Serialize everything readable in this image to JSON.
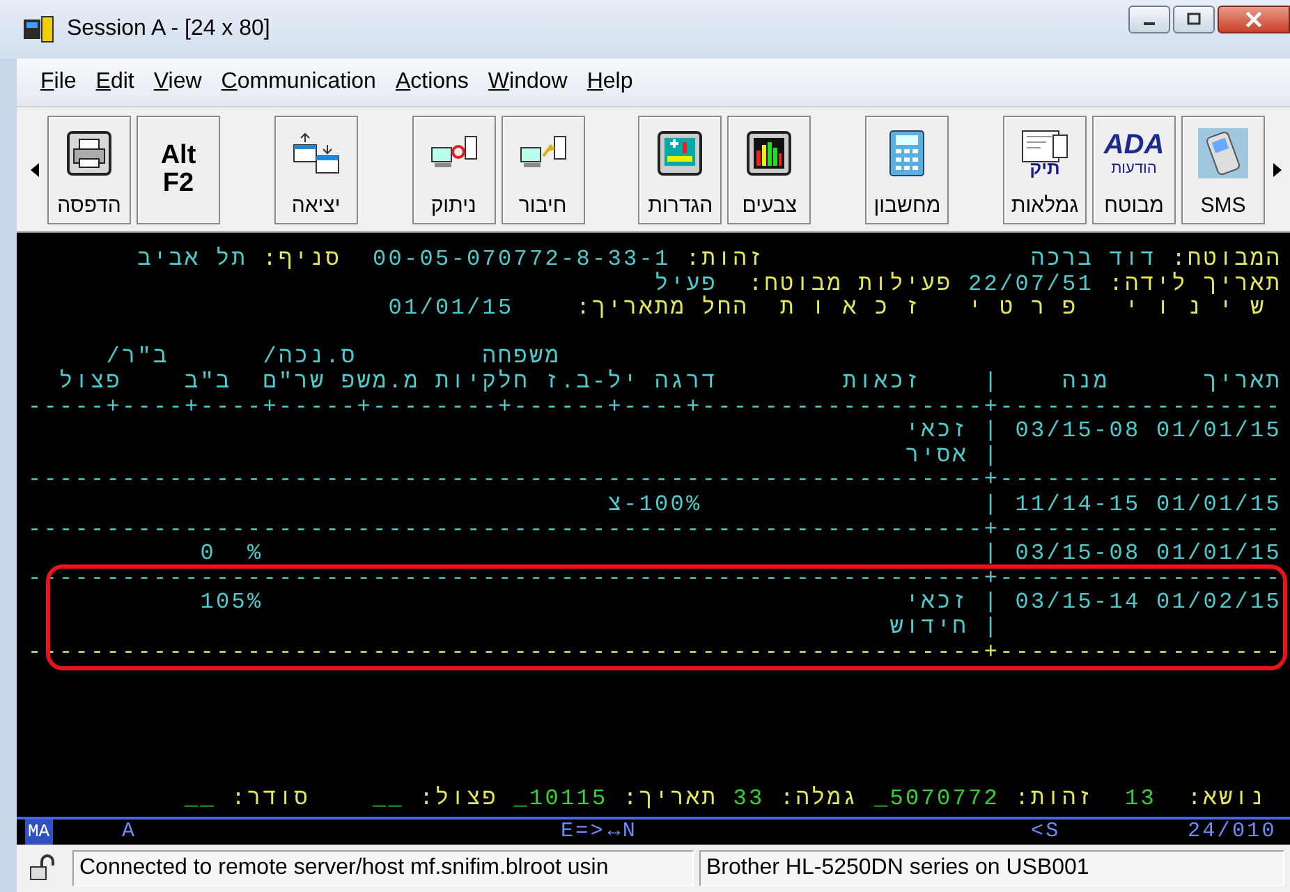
{
  "window": {
    "title": "Session A - [24 x 80]"
  },
  "menu": [
    {
      "label": "Help"
    },
    {
      "label": "Window"
    },
    {
      "label": "Actions"
    },
    {
      "label": "Communication"
    },
    {
      "label": "View"
    },
    {
      "label": "Edit"
    },
    {
      "label": "File"
    }
  ],
  "toolbar": {
    "groups": [
      [
        {
          "kind": "icon",
          "label": "SMS"
        },
        {
          "kind": "icon",
          "label": "מבוטח",
          "icon_text": [
            "ADA",
            "הודעות"
          ]
        },
        {
          "kind": "icon",
          "label": "גמלאות",
          "icon_text": [
            "תיק"
          ]
        }
      ],
      [
        {
          "kind": "icon",
          "label": "מחשבון"
        }
      ],
      [
        {
          "kind": "icon",
          "label": "צבעים"
        },
        {
          "kind": "icon",
          "label": "הגדרות"
        }
      ],
      [
        {
          "kind": "icon",
          "label": "חיבור"
        },
        {
          "kind": "icon",
          "label": "ניתוק"
        }
      ],
      [
        {
          "kind": "icon",
          "label": "יציאה"
        }
      ],
      [
        {
          "kind": "text",
          "lines": [
            "Alt",
            "F2"
          ]
        },
        {
          "kind": "icon",
          "label": "הדפסה"
        }
      ]
    ]
  },
  "terminal": {
    "header_lines": [
      [
        {
          "text": "המבוטח:",
          "kind": "label"
        },
        {
          "text": "דוד ברכה",
          "kind": "value"
        },
        {
          "text": "זהות:",
          "kind": "label"
        },
        {
          "text": "00-05-070772-8-33-1",
          "kind": "value"
        },
        {
          "text": "סניף:",
          "kind": "label"
        },
        {
          "text": "תל אביב",
          "kind": "value"
        }
      ],
      [
        {
          "text": "תאריך לידה:",
          "kind": "label"
        },
        {
          "text": "22/07/51",
          "kind": "value"
        },
        {
          "text": "פעילות מבוטח:",
          "kind": "label"
        },
        {
          "text": "פעיל",
          "kind": "value"
        }
      ],
      [
        {
          "text": "ש י נ ו י   פ ר ט י   ז כ א ו ת",
          "kind": "label"
        },
        {
          "text": "החל מתאריך:",
          "kind": "label"
        },
        {
          "text": "01/01/15",
          "kind": "value"
        }
      ]
    ],
    "blocks": [
      {
        "highlighted": false,
        "lines": [
          {
            "kind": "text",
            "segments": [
              {
                "text": "משפחה",
                "kind": "value"
              },
              {
                "text": "ס.נכה/",
                "kind": "value"
              },
              {
                "text": "ב\"ר/",
                "kind": "value"
              }
            ]
          },
          {
            "kind": "text",
            "segments": [
              {
                "text": "תאריך",
                "kind": "value"
              },
              {
                "text": "מנה",
                "kind": "value"
              },
              {
                "text": "|",
                "kind": "value"
              },
              {
                "text": "זכאות",
                "kind": "value"
              },
              {
                "text": "דרגה",
                "kind": "value"
              },
              {
                "text": "יל-ב.ז",
                "kind": "value"
              },
              {
                "text": "חלקיות",
                "kind": "value"
              },
              {
                "text": "מ.משפ",
                "kind": "value"
              },
              {
                "text": "שר\"ם",
                "kind": "value"
              },
              {
                "text": "ב\"ב",
                "kind": "value"
              },
              {
                "text": "פצול",
                "kind": "value"
              }
            ]
          },
          {
            "kind": "rule",
            "segments": [
              {
                "text": "-----+----+----+-----+--------+------+----+------------------+------------------",
                "kind": "value"
              }
            ]
          }
        ]
      },
      {
        "highlighted": false,
        "lines": [
          {
            "kind": "text",
            "segments": [
              {
                "text": "01/01/15",
                "kind": "value"
              },
              {
                "text": "03/15-08",
                "kind": "value"
              },
              {
                "text": "|",
                "kind": "value"
              },
              {
                "text": "זכאי",
                "kind": "value"
              }
            ]
          },
          {
            "kind": "text",
            "segments": [
              {
                "text": "|",
                "kind": "value"
              },
              {
                "text": "אסיר",
                "kind": "value"
              }
            ]
          },
          {
            "kind": "rule",
            "segments": [
              {
                "text": "-------------------------------------------------------------+------------------",
                "kind": "value"
              }
            ]
          }
        ]
      },
      {
        "highlighted": false,
        "lines": [
          {
            "kind": "text",
            "segments": [
              {
                "text": "01/01/15",
                "kind": "value"
              },
              {
                "text": "11/14-15",
                "kind": "value"
              },
              {
                "text": "|",
                "kind": "value"
              },
              {
                "text": "100%-צ",
                "kind": "value"
              }
            ]
          },
          {
            "kind": "rule",
            "segments": [
              {
                "text": "-------------------------------------------------------------+------------------",
                "kind": "value"
              }
            ]
          }
        ]
      },
      {
        "highlighted": false,
        "lines": [
          {
            "kind": "text",
            "segments": [
              {
                "text": "01/01/15",
                "kind": "value"
              },
              {
                "text": "03/15-08",
                "kind": "value"
              },
              {
                "text": "|",
                "kind": "value"
              },
              {
                "text": "%",
                "kind": "value"
              },
              {
                "text": "0",
                "kind": "value"
              }
            ]
          }
        ]
      },
      {
        "highlighted": true,
        "lines": [
          {
            "kind": "rule",
            "segments": [
              {
                "text": "-------------------------------------------------------------+------------------",
                "kind": "value"
              }
            ]
          },
          {
            "kind": "text",
            "segments": [
              {
                "text": "01/02/15",
                "kind": "value"
              },
              {
                "text": "03/15-14",
                "kind": "value"
              },
              {
                "text": "|",
                "kind": "value"
              },
              {
                "text": "זכאי",
                "kind": "value"
              },
              {
                "text": "105%",
                "kind": "value"
              }
            ]
          },
          {
            "kind": "text",
            "segments": [
              {
                "text": "|",
                "kind": "value"
              },
              {
                "text": "חידוש",
                "kind": "value"
              }
            ]
          },
          {
            "kind": "rule",
            "segments": [
              {
                "text": "-------------------------------------------------------------+------------------",
                "kind": "label"
              }
            ]
          }
        ]
      }
    ],
    "field_line": [
      {
        "text": "נושא:",
        "kind": "label"
      },
      {
        "text": "13",
        "kind": "input"
      },
      {
        "text": "זהות:",
        "kind": "label"
      },
      {
        "text": "5070772_",
        "kind": "input"
      },
      {
        "text": "גמלה:",
        "kind": "label"
      },
      {
        "text": "33",
        "kind": "input"
      },
      {
        "text": "תאריך:",
        "kind": "label"
      },
      {
        "text": "10115_",
        "kind": "input"
      },
      {
        "text": "פצול:",
        "kind": "label"
      },
      {
        "text": "__",
        "kind": "input"
      },
      {
        "text": "סודר:",
        "kind": "label"
      },
      {
        "text": "__",
        "kind": "input"
      }
    ]
  },
  "operator_info": {
    "indicator": "MA",
    "items": [
      "24/010",
      "<S",
      "↔N",
      "E=>",
      "A"
    ]
  },
  "status_bar": {
    "panels": [
      "Brother HL-5250DN series on USB001",
      "Connected to remote server/host mf.snifim.blroot usin"
    ]
  }
}
